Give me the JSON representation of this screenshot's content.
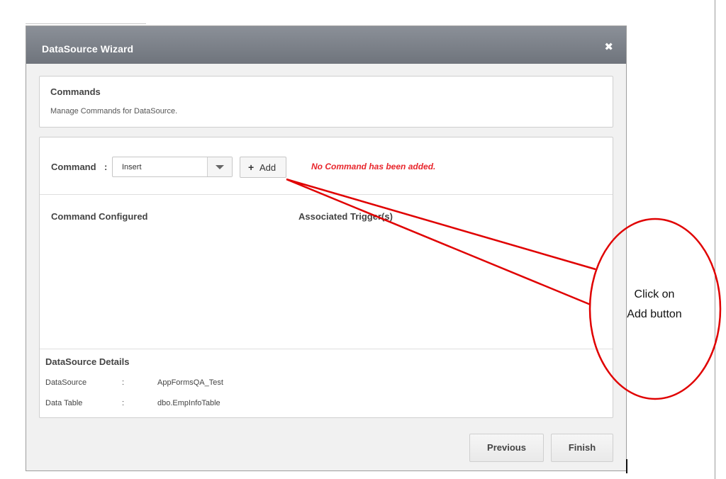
{
  "dialog": {
    "title": "DataSource Wizard",
    "close_glyph": "✖"
  },
  "commands_section": {
    "heading": "Commands",
    "description": "Manage Commands for DataSource."
  },
  "command_row": {
    "label": "Command",
    "colon": ":",
    "selected_command": "Insert",
    "add_glyph": "+",
    "add_label": "Add",
    "status_message": "No Command has been added."
  },
  "columns": {
    "configured": "Command Configured",
    "triggers": "Associated Trigger(s)"
  },
  "details": {
    "heading": "DataSource Details",
    "rows": [
      {
        "key": "DataSource",
        "sep": ":",
        "value": "AppFormsQA_Test"
      },
      {
        "key": "Data Table",
        "sep": ":",
        "value": "dbo.EmpInfoTable"
      }
    ]
  },
  "footer": {
    "previous_label": "Previous",
    "finish_label": "Finish"
  },
  "annotation": {
    "line1": "Click on",
    "line2": "Add button"
  },
  "colors": {
    "titlebar": "#7c8189",
    "status_message": "#e8262c",
    "annotation": "#e00000"
  }
}
